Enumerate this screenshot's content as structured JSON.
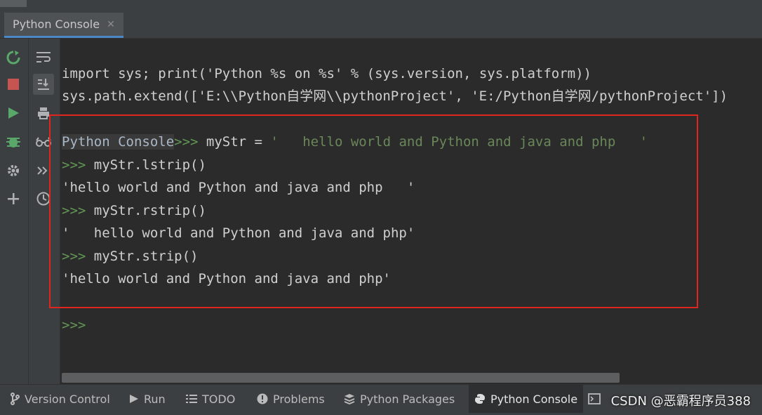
{
  "tab": {
    "label": "Python Console",
    "close": "✕"
  },
  "console": {
    "lines": {
      "l1": "import sys; print('Python %s on %s' % (sys.version, sys.platform))",
      "l2": "sys.path.extend(['E:\\\\Python自学网\\\\pythonProject', 'E:/Python自学网/pythonProject'])",
      "l3_label": "Python Console",
      "l3_prompt": ">>> ",
      "l3_code": "myStr = ",
      "l3_str": "'   hello world and Python and java and php   '",
      "l4_prompt": ">>> ",
      "l4_code": "myStr.lstrip()",
      "l5": "'hello world and Python and java and php   '",
      "l6_prompt": ">>> ",
      "l6_code": "myStr.rstrip()",
      "l7": "'   hello world and Python and java and php'",
      "l8_prompt": ">>> ",
      "l8_code": "myStr.strip()",
      "l9": "'hello world and Python and java and php'",
      "l10_prompt": ">>>"
    }
  },
  "bottom_tabs": {
    "version_control": "Version Control",
    "run": "Run",
    "todo": "TODO",
    "problems": "Problems",
    "python_packages": "Python Packages",
    "python_console": "Python Console"
  },
  "watermark": "CSDN @恶霸程序员388",
  "colors": {
    "accent_red": "#e0251f",
    "prompt_green": "#629755",
    "tab_underline": "#4a88c7"
  },
  "icons": {
    "left": [
      "rerun-icon",
      "stop-icon",
      "run-icon",
      "debug-icon",
      "settings-icon",
      "add-icon"
    ],
    "mid": [
      "soft-wrap-icon",
      "scroll-to-end-icon",
      "print-icon",
      "show-variables-icon",
      "execute-icon",
      "history-icon"
    ]
  }
}
